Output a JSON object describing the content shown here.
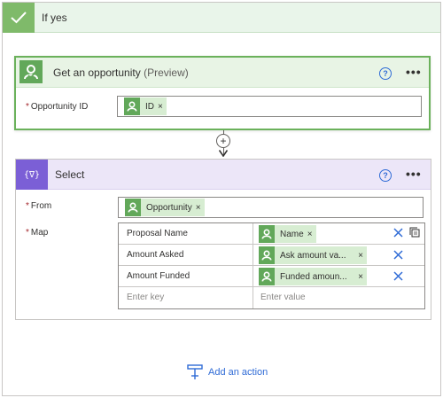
{
  "branch": {
    "label": "If yes",
    "icon": "check-icon"
  },
  "get_opportunity": {
    "title": "Get an opportunity",
    "title_suffix": "(Preview)",
    "icon": "dataverse-icon",
    "fields": {
      "opportunity_id": {
        "label": "Opportunity ID",
        "required": true,
        "token": "ID"
      }
    }
  },
  "connector": {
    "plus": "+"
  },
  "select": {
    "title": "Select",
    "icon_glyph": "{∇}",
    "from": {
      "label": "From",
      "required": true,
      "token": "Opportunity"
    },
    "map": {
      "label": "Map",
      "required": true,
      "rows": [
        {
          "key": "Proposal Name",
          "value_token": "Name"
        },
        {
          "key": "Amount Asked",
          "value_token": "Ask amount va..."
        },
        {
          "key": "Amount Funded",
          "value_token": "Funded amoun..."
        }
      ],
      "key_placeholder": "Enter key",
      "value_placeholder": "Enter value"
    }
  },
  "common": {
    "help": "?",
    "more": "•••",
    "remove": "×",
    "required_mark": "*"
  },
  "add_action": {
    "label": "Add an action"
  },
  "colors": {
    "accent_blue": "#2f6bd6",
    "dataverse_green": "#62a85a",
    "select_purple": "#7b5fd6",
    "required_red": "#a4262c"
  }
}
